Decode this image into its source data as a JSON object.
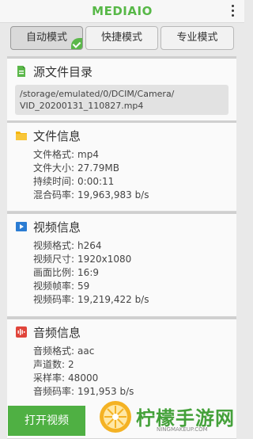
{
  "app": {
    "logo": "MEDIAIO"
  },
  "tabs": [
    {
      "label": "自动模式",
      "active": true
    },
    {
      "label": "快捷模式",
      "active": false
    },
    {
      "label": "专业模式",
      "active": false
    }
  ],
  "source": {
    "title": "源文件目录",
    "path": "/storage/emulated/0/DCIM/Camera/\nVID_20200131_110827.mp4"
  },
  "file_info": {
    "title": "文件信息",
    "rows": [
      {
        "key": "文件格式:",
        "value": "mp4"
      },
      {
        "key": "文件大小:",
        "value": "27.79MB"
      },
      {
        "key": "持续时间:",
        "value": "0:00:11"
      },
      {
        "key": "混合码率:",
        "value": "19,963,983 b/s"
      }
    ]
  },
  "video_info": {
    "title": "视频信息",
    "rows": [
      {
        "key": "视频格式:",
        "value": "h264"
      },
      {
        "key": "视频尺寸:",
        "value": "1920x1080"
      },
      {
        "key": "画面比例:",
        "value": "16:9"
      },
      {
        "key": "视频帧率:",
        "value": "59"
      },
      {
        "key": "视频码率:",
        "value": "19,219,422 b/s"
      }
    ]
  },
  "audio_info": {
    "title": "音频信息",
    "rows": [
      {
        "key": "音频格式:",
        "value": "aac"
      },
      {
        "key": "声道数:",
        "value": "2"
      },
      {
        "key": "采样率:",
        "value": "48000"
      },
      {
        "key": "音频码率:",
        "value": "191,953 b/s"
      }
    ]
  },
  "open_button": {
    "label": "打开视频"
  },
  "watermark": {
    "text": "柠檬手游网",
    "sub": "NINGMAKEUP.COM"
  },
  "colors": {
    "accent": "#4fb043",
    "folder": "#f5b50a",
    "video": "#2b7cd3",
    "audio": "#e0443a"
  }
}
